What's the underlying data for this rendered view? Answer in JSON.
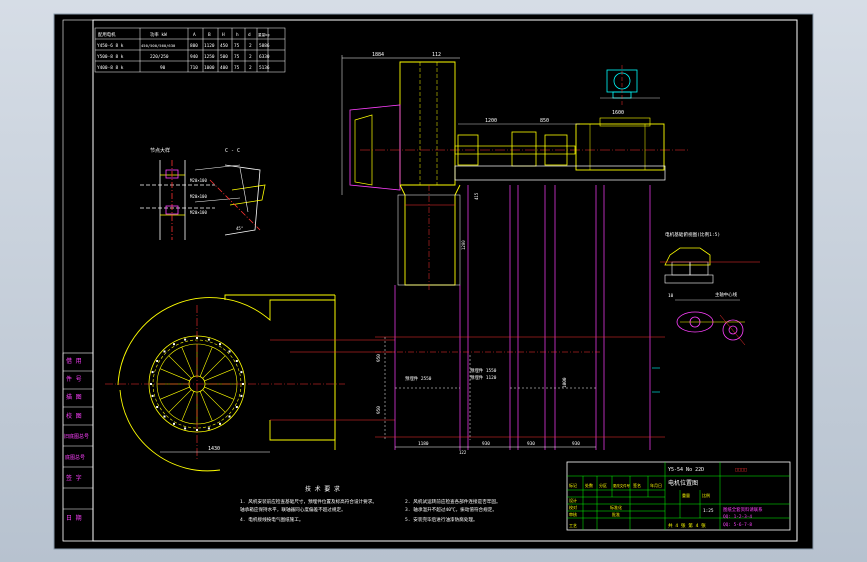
{
  "colors": {
    "background": "#000000",
    "line_white": "#ffffff",
    "line_yellow": "#ffff00",
    "line_magenta": "#ff40ff",
    "line_cyan": "#00ffff",
    "line_red": "#ff3030",
    "line_green": "#00ff00",
    "frame": "#cfd6e0"
  },
  "specs_table": {
    "headers": [
      "配用电机",
      "功率 kW",
      "A",
      "B",
      "H",
      "h",
      "d",
      "重量kg"
    ],
    "rows": [
      [
        "Y450-6  8 k",
        "450/500/560/630",
        "800",
        "1120",
        "450",
        "75",
        "2",
        "5886"
      ],
      [
        "Y500-8  8 k",
        "220/250",
        "940",
        "1250",
        "500",
        "75",
        "2",
        "6330"
      ],
      [
        "Y400-8  8 k",
        "90",
        "710",
        "1000",
        "400",
        "75",
        "2",
        "5136"
      ]
    ]
  },
  "view_labels": {
    "section_title": "C - C",
    "detail_label": "节点大样",
    "motor_view_label": "电机基础俯视图(比例1:5)",
    "right_detail_label": "主轴中心线"
  },
  "dimensions": {
    "top_span_1": "1884",
    "top_span_2": "112",
    "mid_1": "1200",
    "mid_2": "850",
    "mid_3": "1600",
    "base_1": "1180",
    "base_2": "930",
    "base_3": "930",
    "base_4": "930",
    "vert_1": "950",
    "vert_2": "950",
    "vert_3": "1000",
    "scroll_width": "1430",
    "right_dim": "10",
    "anchor_1": "预埋件 2550",
    "anchor_2": "预埋件 1550"
  },
  "tech_requirements": {
    "title": "技 术 要 求",
    "items": [
      "1. 风机安装前应检查基础尺寸，预埋件位置及标高符合设计要求。",
      "   轴承箱应保持水平，联轴器同心度偏差不超过规定。",
      "2. 风机试运转前应检查各部件连接是否牢固。",
      "3. 轴承温升不超过40℃，振动值符合规定。",
      "4. 电机接线按电气图纸施工。",
      "5. 安装完毕后进行油漆防腐处理。"
    ]
  },
  "left_strip": {
    "labels": [
      "借 用",
      "件 号",
      "描 图",
      "校 图",
      "旧底图总号",
      "底图总号",
      "签 字",
      "日 期"
    ]
  },
  "title_block": {
    "drawing_code": "Y5-54 No 22D",
    "drawing_name": "电机位置图",
    "company": "□□□□",
    "stage_labels": [
      "标记",
      "处数",
      "分区",
      "更改文件号",
      "签名",
      "年月日"
    ],
    "role_labels": [
      "设计",
      "校对",
      "审核",
      "工艺",
      "标准化",
      "批准"
    ],
    "scale_label": "比例",
    "scale_value": "1:25",
    "weight_label": "重量",
    "sheet_info": "共 4 张   第 4 张",
    "contact_1": "图纸全套资料请联系",
    "contact_2": "QQ: 1-2-3-4",
    "contact_3": "QQ: 5-6-7-8"
  }
}
